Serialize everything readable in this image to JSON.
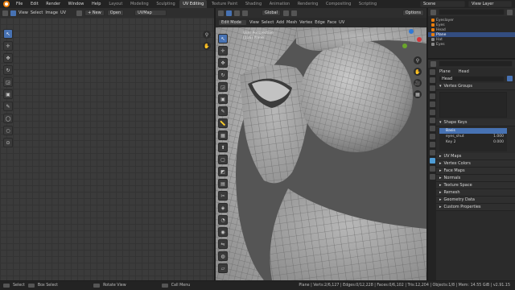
{
  "menu": [
    "File",
    "Edit",
    "Render",
    "Window",
    "Help"
  ],
  "workspaces": [
    "Layout",
    "Modeling",
    "Sculpting",
    "UV Editing",
    "Texture Paint",
    "Shading",
    "Animation",
    "Rendering",
    "Compositing",
    "Scripting"
  ],
  "active_workspace": "UV Editing",
  "scene": {
    "label": "Scene"
  },
  "view_layer": {
    "label": "View Layer"
  },
  "uv_header": {
    "menus": [
      "View",
      "Select",
      "Image",
      "UV"
    ],
    "new_label": "New",
    "open_label": "Open",
    "uvmap_label": "UVMap"
  },
  "vp_header": {
    "mode": "Edit Mode",
    "menus": [
      "View",
      "Select",
      "Add",
      "Mesh",
      "Vertex",
      "Edge",
      "Face",
      "UV"
    ],
    "orientation": "Global",
    "options": "Options"
  },
  "vp_overlay": {
    "view_name": "User Perspective",
    "object_name": "(116) Plane"
  },
  "outliner": {
    "items": [
      "Eyeslayer",
      "Eyes",
      "Head",
      "Plane",
      "Hat",
      "Eyes"
    ],
    "selected": "Plane"
  },
  "props": {
    "object": "Plane",
    "mesh": "Head",
    "data_name": "Head"
  },
  "panels": {
    "vertex_groups": "Vertex Groups",
    "shape_keys": "Shape Keys",
    "uv_maps": "UV Maps",
    "vertex_colors": "Vertex Colors",
    "face_maps": "Face Maps",
    "normals": "Normals",
    "texture_space": "Texture Space",
    "remesh": "Remesh",
    "geometry_data": "Geometry Data",
    "custom_properties": "Custom Properties"
  },
  "shape_keys": [
    {
      "name": "Basis",
      "value": ""
    },
    {
      "name": "eyes_shut",
      "value": "1.000"
    },
    {
      "name": "Key 2",
      "value": "0.000"
    }
  ],
  "status": {
    "select": "Select",
    "box_select": "Box Select",
    "rotate_view": "Rotate View",
    "call_menu": "Call Menu",
    "stats": "Plane | Verts:2/6,127 | Edges:0/12,228 | Faces:0/6,102 | Tris:12,204 | Objects:1/8 | Mem: 14.55 GiB | v2.91.15"
  },
  "colors": {
    "accent": "#4772b3",
    "orange": "#e87d0d",
    "mesh": "#a9a9a9"
  }
}
